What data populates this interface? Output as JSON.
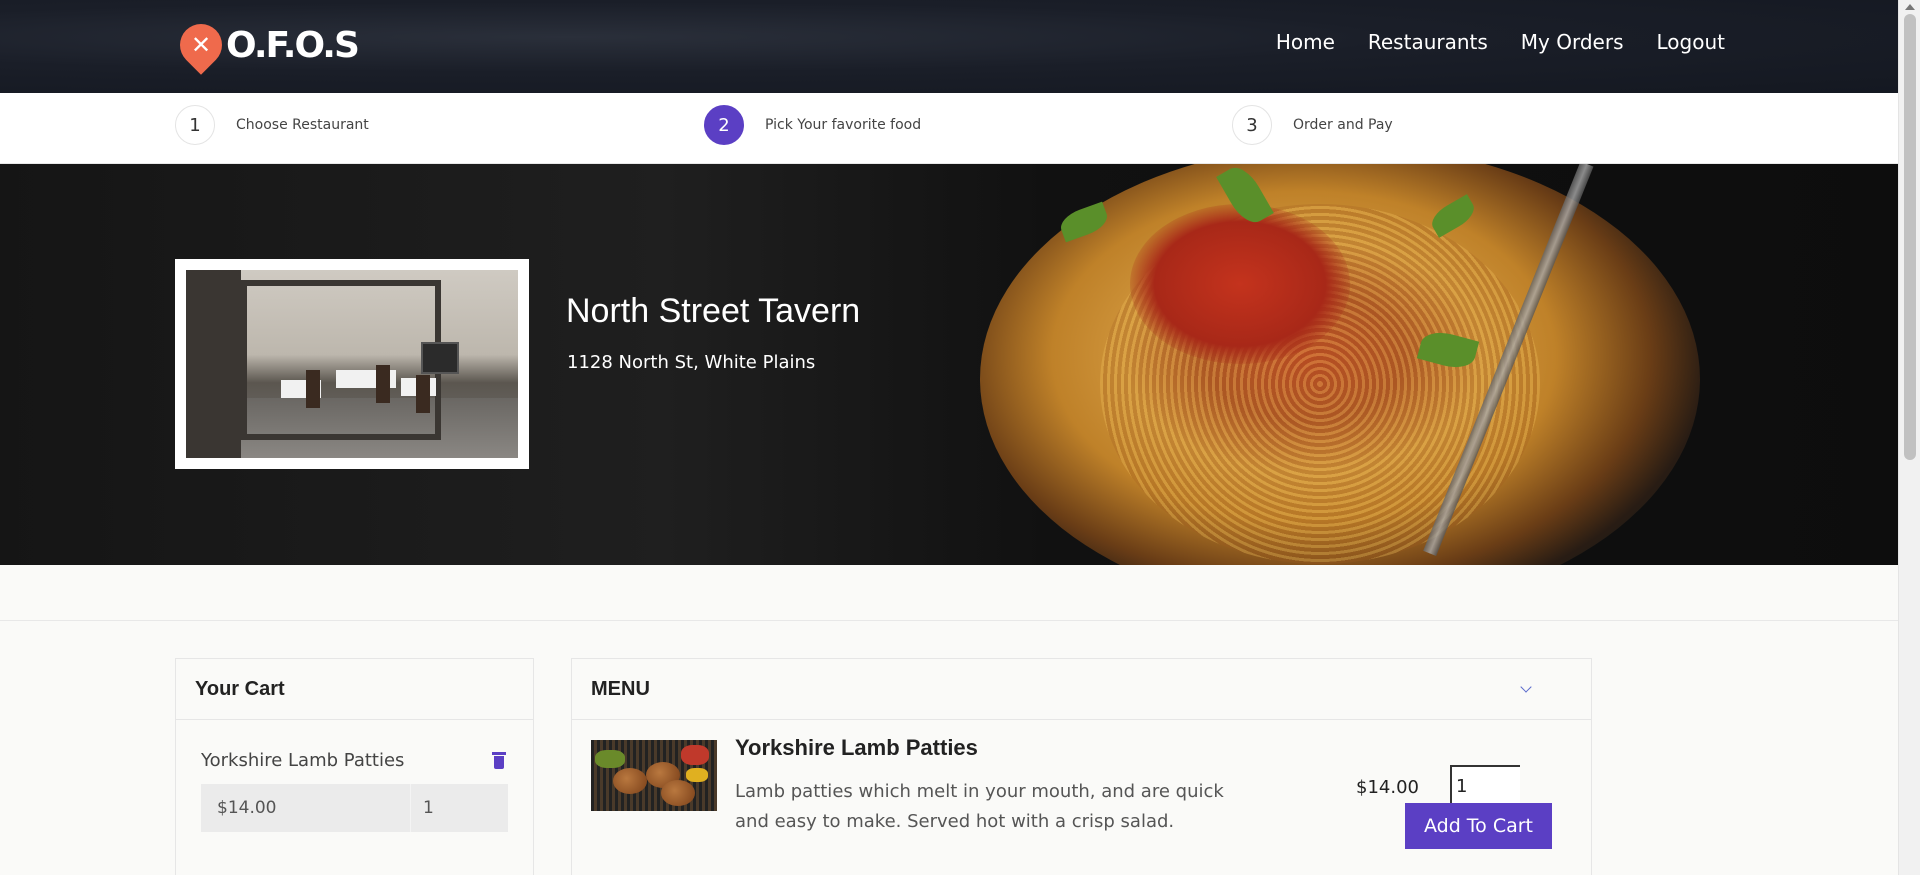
{
  "header": {
    "logo_text": "O.F.O.S",
    "nav": [
      "Home",
      "Restaurants",
      "My Orders",
      "Logout"
    ]
  },
  "steps": [
    {
      "num": "1",
      "label": "Choose Restaurant",
      "active": false
    },
    {
      "num": "2",
      "label": "Pick Your favorite food",
      "active": true
    },
    {
      "num": "3",
      "label": "Order and Pay",
      "active": false
    }
  ],
  "restaurant": {
    "name": "North Street Tavern",
    "address": "1128 North St, White Plains"
  },
  "cart": {
    "title": "Your Cart",
    "items": [
      {
        "name": "Yorkshire Lamb Patties",
        "price": "$14.00",
        "qty": "1"
      }
    ]
  },
  "menu": {
    "title": "MENU",
    "items": [
      {
        "name": "Yorkshire Lamb Patties",
        "description": "Lamb patties which melt in your mouth, and are quick and easy to make. Served hot with a crisp salad.",
        "price": "$14.00",
        "qty": "1",
        "button": "Add To Cart"
      }
    ]
  },
  "colors": {
    "accent": "#5b3fc4",
    "header_bg": "#1a1e28",
    "logo": "#ef6a4c"
  }
}
